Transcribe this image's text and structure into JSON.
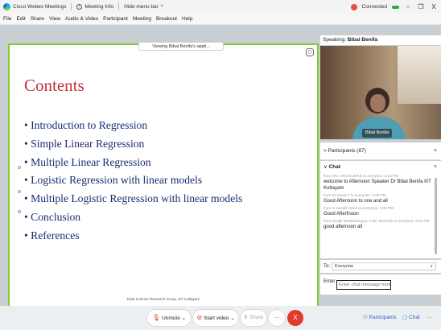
{
  "titlebar": {
    "app_name": "Cisco Webex Meetings",
    "meeting_info": "Meeting Info",
    "hide_menu": "Hide menu bar",
    "hide_chevron": "^",
    "status": "Connected",
    "minimize": "–",
    "restore": "❐",
    "close": "X",
    "info_glyph": "i",
    "accent_green": "#30a84a"
  },
  "menu": [
    "File",
    "Edit",
    "Share",
    "View",
    "Audio & Video",
    "Participant",
    "Meeting",
    "Breakout",
    "Help"
  ],
  "share": {
    "banner": "Viewing Bibal Benifa's appli...",
    "stop_glyph": "◻",
    "border_color": "#7ccc30"
  },
  "slide": {
    "title": "Contents",
    "bullets": [
      "• Introduction to Regression",
      "• Simple Linear Regression",
      "• Multiple Linear Regression",
      "• Logistic Regression with linear models",
      "• Multiple Logistic Regression with linear models",
      "• Conclusion",
      "• References"
    ],
    "footer": "Data Science Research Group, IIIT Kottayam",
    "title_color": "#c0303e",
    "text_color": "#1b2a72"
  },
  "speaking": {
    "label": "Speaking:",
    "name": "Bibal Benifa"
  },
  "video": {
    "name_tag": "Bibal Benifa"
  },
  "participants": {
    "label": "Participants (87)",
    "chevron": ">",
    "close": "×"
  },
  "chat": {
    "label": "Chat",
    "chevron": "∨",
    "close": "×",
    "messages": [
      {
        "meta": "from DR.A.RAJKUMAR to everyone:   2:22 PM",
        "text": "welcome to Afternoon Speaker Dr Bibal Benifa IIIT Kottayam"
      },
      {
        "meta": "from Dr Suma T to everyone:   2:28 PM",
        "text": "Good Afternoon to one and all"
      },
      {
        "meta": "from G Senthil Velan to everyone:   2:30 PM",
        "text": "Good Afterfnoon"
      },
      {
        "meta": "from Surajit Bhattacharyya, CSE, MCKVIE to everyone:   2:31 PM",
        "text": "good afternoon all"
      }
    ],
    "to_label": "To:",
    "to_value": "Everyone",
    "to_chevron": "∨",
    "enter_label": "Enter",
    "input_placeholder": "Enter chat message here"
  },
  "controls": {
    "unmute": "Unmute",
    "start_video": "Start video",
    "share": "Share",
    "more": "···",
    "end": "X",
    "participants": "Participants",
    "chat": "Chat",
    "overflow": "···",
    "dropdown": "⌄",
    "mic_glyph": "🎙",
    "video_glyph": "⊘",
    "share_glyph": "⬆",
    "people_glyph": "⚇",
    "chat_glyph": "▢",
    "end_color": "#e23b2e"
  }
}
